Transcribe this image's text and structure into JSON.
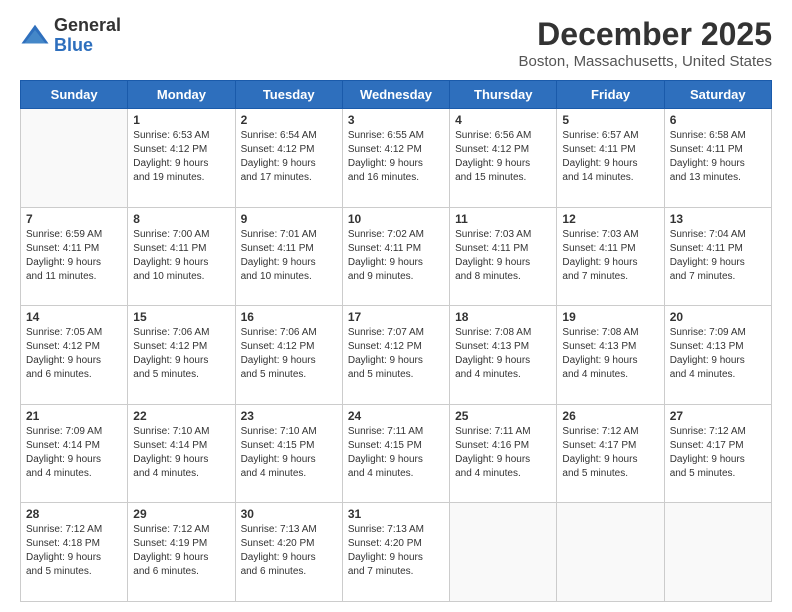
{
  "header": {
    "logo_general": "General",
    "logo_blue": "Blue",
    "month_title": "December 2025",
    "location": "Boston, Massachusetts, United States"
  },
  "days_of_week": [
    "Sunday",
    "Monday",
    "Tuesday",
    "Wednesday",
    "Thursday",
    "Friday",
    "Saturday"
  ],
  "weeks": [
    [
      {
        "day": "",
        "info": ""
      },
      {
        "day": "1",
        "info": "Sunrise: 6:53 AM\nSunset: 4:12 PM\nDaylight: 9 hours\nand 19 minutes."
      },
      {
        "day": "2",
        "info": "Sunrise: 6:54 AM\nSunset: 4:12 PM\nDaylight: 9 hours\nand 17 minutes."
      },
      {
        "day": "3",
        "info": "Sunrise: 6:55 AM\nSunset: 4:12 PM\nDaylight: 9 hours\nand 16 minutes."
      },
      {
        "day": "4",
        "info": "Sunrise: 6:56 AM\nSunset: 4:12 PM\nDaylight: 9 hours\nand 15 minutes."
      },
      {
        "day": "5",
        "info": "Sunrise: 6:57 AM\nSunset: 4:11 PM\nDaylight: 9 hours\nand 14 minutes."
      },
      {
        "day": "6",
        "info": "Sunrise: 6:58 AM\nSunset: 4:11 PM\nDaylight: 9 hours\nand 13 minutes."
      }
    ],
    [
      {
        "day": "7",
        "info": "Sunrise: 6:59 AM\nSunset: 4:11 PM\nDaylight: 9 hours\nand 11 minutes."
      },
      {
        "day": "8",
        "info": "Sunrise: 7:00 AM\nSunset: 4:11 PM\nDaylight: 9 hours\nand 10 minutes."
      },
      {
        "day": "9",
        "info": "Sunrise: 7:01 AM\nSunset: 4:11 PM\nDaylight: 9 hours\nand 10 minutes."
      },
      {
        "day": "10",
        "info": "Sunrise: 7:02 AM\nSunset: 4:11 PM\nDaylight: 9 hours\nand 9 minutes."
      },
      {
        "day": "11",
        "info": "Sunrise: 7:03 AM\nSunset: 4:11 PM\nDaylight: 9 hours\nand 8 minutes."
      },
      {
        "day": "12",
        "info": "Sunrise: 7:03 AM\nSunset: 4:11 PM\nDaylight: 9 hours\nand 7 minutes."
      },
      {
        "day": "13",
        "info": "Sunrise: 7:04 AM\nSunset: 4:11 PM\nDaylight: 9 hours\nand 7 minutes."
      }
    ],
    [
      {
        "day": "14",
        "info": "Sunrise: 7:05 AM\nSunset: 4:12 PM\nDaylight: 9 hours\nand 6 minutes."
      },
      {
        "day": "15",
        "info": "Sunrise: 7:06 AM\nSunset: 4:12 PM\nDaylight: 9 hours\nand 5 minutes."
      },
      {
        "day": "16",
        "info": "Sunrise: 7:06 AM\nSunset: 4:12 PM\nDaylight: 9 hours\nand 5 minutes."
      },
      {
        "day": "17",
        "info": "Sunrise: 7:07 AM\nSunset: 4:12 PM\nDaylight: 9 hours\nand 5 minutes."
      },
      {
        "day": "18",
        "info": "Sunrise: 7:08 AM\nSunset: 4:13 PM\nDaylight: 9 hours\nand 4 minutes."
      },
      {
        "day": "19",
        "info": "Sunrise: 7:08 AM\nSunset: 4:13 PM\nDaylight: 9 hours\nand 4 minutes."
      },
      {
        "day": "20",
        "info": "Sunrise: 7:09 AM\nSunset: 4:13 PM\nDaylight: 9 hours\nand 4 minutes."
      }
    ],
    [
      {
        "day": "21",
        "info": "Sunrise: 7:09 AM\nSunset: 4:14 PM\nDaylight: 9 hours\nand 4 minutes."
      },
      {
        "day": "22",
        "info": "Sunrise: 7:10 AM\nSunset: 4:14 PM\nDaylight: 9 hours\nand 4 minutes."
      },
      {
        "day": "23",
        "info": "Sunrise: 7:10 AM\nSunset: 4:15 PM\nDaylight: 9 hours\nand 4 minutes."
      },
      {
        "day": "24",
        "info": "Sunrise: 7:11 AM\nSunset: 4:15 PM\nDaylight: 9 hours\nand 4 minutes."
      },
      {
        "day": "25",
        "info": "Sunrise: 7:11 AM\nSunset: 4:16 PM\nDaylight: 9 hours\nand 4 minutes."
      },
      {
        "day": "26",
        "info": "Sunrise: 7:12 AM\nSunset: 4:17 PM\nDaylight: 9 hours\nand 5 minutes."
      },
      {
        "day": "27",
        "info": "Sunrise: 7:12 AM\nSunset: 4:17 PM\nDaylight: 9 hours\nand 5 minutes."
      }
    ],
    [
      {
        "day": "28",
        "info": "Sunrise: 7:12 AM\nSunset: 4:18 PM\nDaylight: 9 hours\nand 5 minutes."
      },
      {
        "day": "29",
        "info": "Sunrise: 7:12 AM\nSunset: 4:19 PM\nDaylight: 9 hours\nand 6 minutes."
      },
      {
        "day": "30",
        "info": "Sunrise: 7:13 AM\nSunset: 4:20 PM\nDaylight: 9 hours\nand 6 minutes."
      },
      {
        "day": "31",
        "info": "Sunrise: 7:13 AM\nSunset: 4:20 PM\nDaylight: 9 hours\nand 7 minutes."
      },
      {
        "day": "",
        "info": ""
      },
      {
        "day": "",
        "info": ""
      },
      {
        "day": "",
        "info": ""
      }
    ]
  ]
}
